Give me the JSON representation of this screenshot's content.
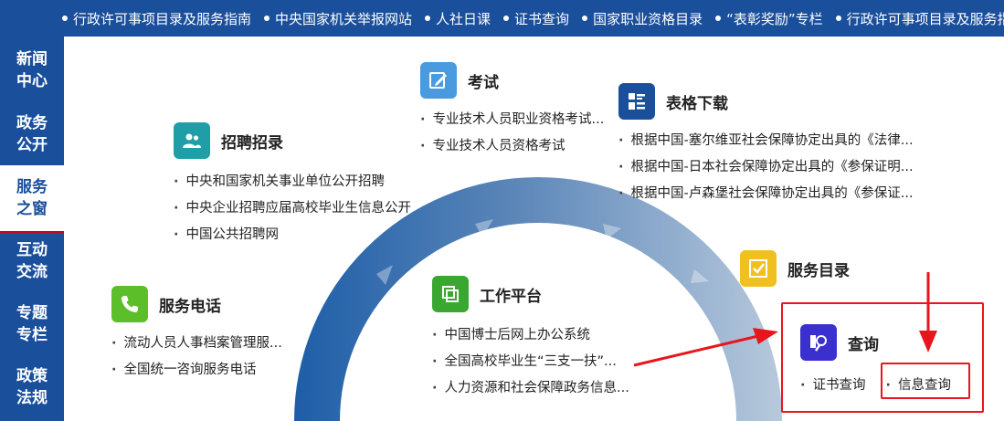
{
  "topbar": {
    "links": [
      "行政许可事项目录及服务指南",
      "中央国家机关举报网站",
      "人社日课",
      "证书查询",
      "国家职业资格目录",
      "“表彰奖励”专栏",
      "行政许可事项目录及服务指南"
    ]
  },
  "sidenav": {
    "items": [
      {
        "label": "新闻中心",
        "l1": "新闻",
        "l2": "中心"
      },
      {
        "label": "政务公开",
        "l1": "政务",
        "l2": "公开"
      },
      {
        "label": "服务之窗",
        "l1": "服务",
        "l2": "之窗"
      },
      {
        "label": "互动交流",
        "l1": "互动",
        "l2": "交流"
      },
      {
        "label": "专题专栏",
        "l1": "专题",
        "l2": "专栏"
      },
      {
        "label": "政策法规",
        "l1": "政策",
        "l2": "法规"
      }
    ],
    "active_index": 2
  },
  "sections": {
    "recruit": {
      "title": "招聘招录",
      "items": [
        "中央和国家机关事业单位公开招聘",
        "中央企业招聘应届高校毕业生信息公开",
        "中国公共招聘网"
      ]
    },
    "exam": {
      "title": "考试",
      "items": [
        "专业技术人员职业资格考试...",
        "专业技术人员资格考试"
      ]
    },
    "forms": {
      "title": "表格下载",
      "items": [
        "根据中国-塞尔维亚社会保障协定出具的《法律...",
        "根据中国-日本社会保障协定出具的《参保证明...",
        "根据中国-卢森堡社会保障协定出具的《参保证..."
      ]
    },
    "phone": {
      "title": "服务电话",
      "items": [
        "流动人员人事档案管理服...",
        "全国统一咨询服务电话"
      ]
    },
    "platform": {
      "title": "工作平台",
      "items": [
        "中国博士后网上办公系统",
        "全国高校毕业生“三支一扶”...",
        "人力资源和社会保障政务信息..."
      ]
    },
    "catalog": {
      "title": "服务目录"
    },
    "query": {
      "title": "查询",
      "items": [
        "证书查询",
        "信息查询"
      ]
    }
  },
  "colors": {
    "nav_blue": "#1a4f9c",
    "highlight_red": "#e8161c",
    "recruit_icon": "#1f9ea7",
    "exam_icon": "#4a9ae0",
    "forms_icon": "#1a4f9c",
    "phone_icon": "#5cbf2a",
    "platform_icon": "#3aa830",
    "catalog_icon": "#f0c020",
    "query_icon": "#3a2fcf"
  }
}
